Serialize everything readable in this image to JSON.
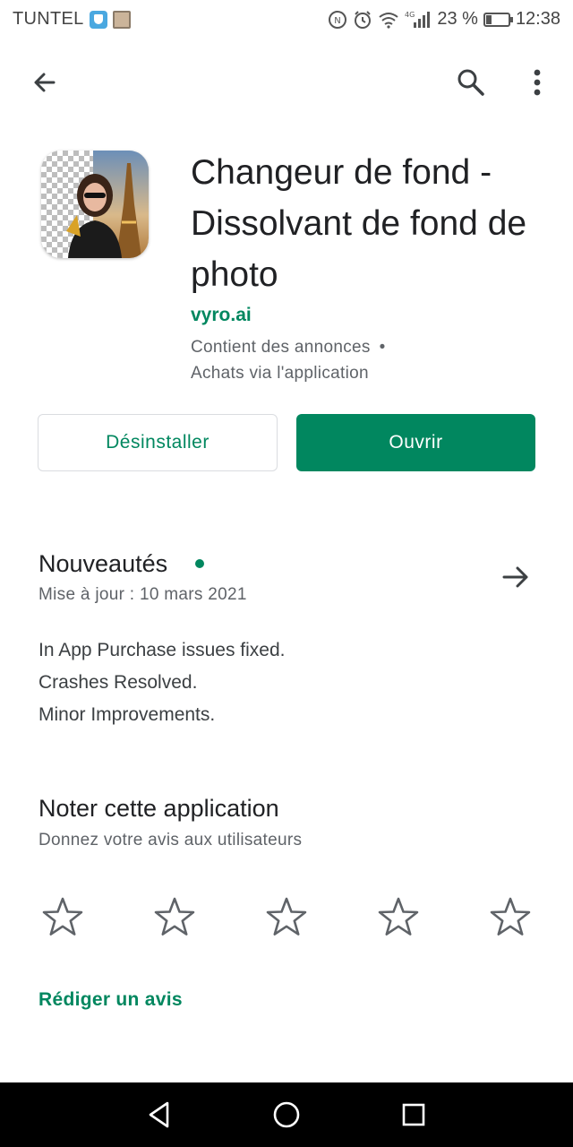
{
  "status_bar": {
    "carrier": "TUNTEL",
    "network": "4G",
    "battery_percent": "23 %",
    "battery_level": 0.23,
    "time": "12:38",
    "icons": [
      "shield-icon",
      "photo-thumb-icon",
      "nfc-icon",
      "alarm-icon",
      "wifi-icon",
      "signal-icon",
      "battery-icon"
    ]
  },
  "app_bar": {
    "icons": [
      "back-arrow-icon",
      "search-icon",
      "more-vert-icon"
    ]
  },
  "app": {
    "title_lines": [
      "Changeur de fond -",
      "Dissolvant de fond de",
      "photo"
    ],
    "developer": "vyro.ai",
    "meta_ads": "Contient des annonces",
    "meta_separator": "•",
    "meta_iap": "Achats via l'application"
  },
  "actions": {
    "uninstall_label": "Désinstaller",
    "open_label": "Ouvrir"
  },
  "whats_new": {
    "title": "Nouveautés",
    "updated": "Mise à jour : 10 mars 2021",
    "notes": [
      "In App Purchase issues fixed.",
      "Crashes Resolved.",
      "Minor Improvements."
    ]
  },
  "rate": {
    "title": "Noter cette application",
    "subtitle": "Donnez votre avis aux utilisateurs",
    "stars_total": 5,
    "stars_selected": 0,
    "write_review_label": "Rédiger un avis"
  },
  "nav_bar": {
    "icons": [
      "nav-back-icon",
      "nav-home-icon",
      "nav-recents-icon"
    ]
  },
  "colors": {
    "accent": "#01875f",
    "text_primary": "#202124",
    "text_secondary": "#5f6368"
  }
}
